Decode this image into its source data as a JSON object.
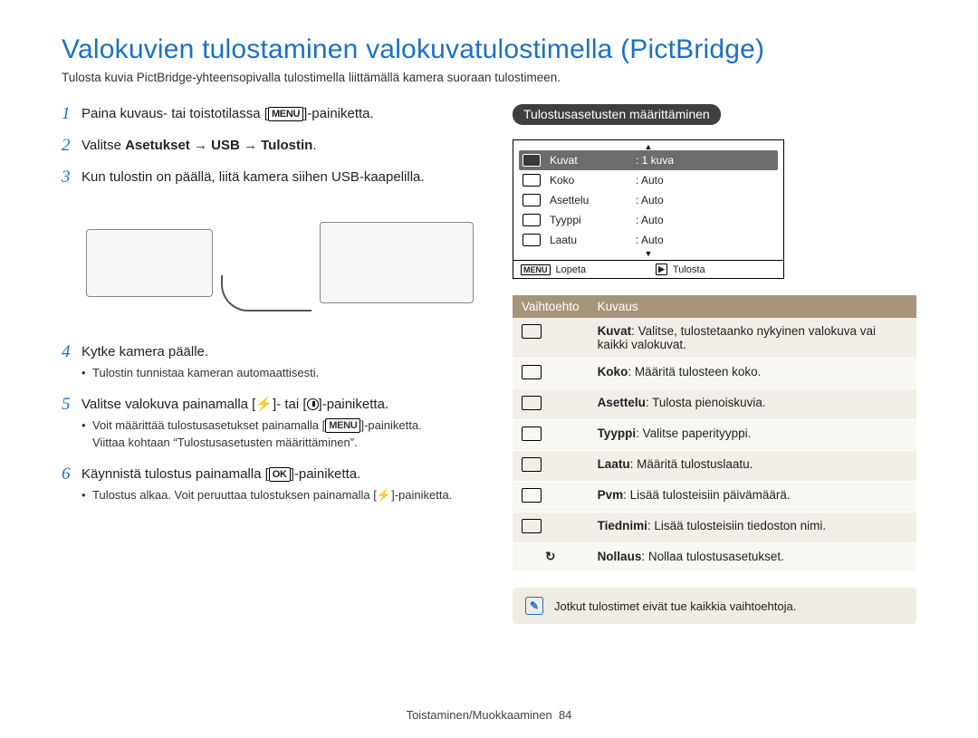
{
  "page": {
    "title": "Valokuvien tulostaminen valokuvatulostimella (PictBridge)",
    "subtitle": "Tulosta kuvia PictBridge-yhteensopivalla tulostimella liittämällä kamera suoraan tulostimeen.",
    "footer_section": "Toistaminen/Muokkaaminen",
    "footer_page": "84"
  },
  "buttons": {
    "menu": "MENU",
    "ok": "OK"
  },
  "steps": [
    {
      "n": "1",
      "parts": [
        "Paina kuvaus- tai toistotilassa [",
        "MENU",
        "]-painiketta."
      ]
    },
    {
      "n": "2",
      "parts_bold": [
        "Valitse ",
        "Asetukset → USB → Tulostin",
        "."
      ]
    },
    {
      "n": "3",
      "text": "Kun tulostin on päällä, liitä kamera siihen USB-kaapelilla."
    },
    {
      "n": "4",
      "text": "Kytke kamera päälle.",
      "bullets": [
        "Tulostin tunnistaa kameran automaattisesti."
      ]
    },
    {
      "n": "5",
      "parts": [
        "Valitse valokuva painamalla [",
        "flash",
        "]- tai [",
        "timer",
        "]-painiketta."
      ],
      "bullets": [
        "Voit määrittää tulostusasetukset painamalla [MENU]-painiketta. Viittaa kohtaan \"Tulostusasetusten määrittäminen\"."
      ],
      "bullets_rich": {
        "line1_pre": "Voit määrittää tulostusasetukset painamalla",
        "line1_btn": "MENU",
        "line1_post": "-painiketta.",
        "line2": "Viittaa kohtaan “Tulostusasetusten määrittäminen”."
      }
    },
    {
      "n": "6",
      "parts": [
        "Käynnistä tulostus painamalla [",
        "OK",
        "]-painiketta."
      ],
      "bullets_rich": {
        "line1_pre": "Tulostus alkaa. Voit peruuttaa tulostuksen painamalla",
        "line1_post": "-painiketta."
      }
    }
  ],
  "settings": {
    "heading": "Tulostusasetusten määrittäminen",
    "lcd": {
      "rows": [
        {
          "label": "Kuvat",
          "value": ": 1 kuva",
          "selected": true
        },
        {
          "label": "Koko",
          "value": ": Auto"
        },
        {
          "label": "Asettelu",
          "value": ": Auto"
        },
        {
          "label": "Tyyppi",
          "value": ": Auto"
        },
        {
          "label": "Laatu",
          "value": ": Auto"
        }
      ],
      "foot_left_key": "MENU",
      "foot_left": "Lopeta",
      "foot_right": "Tulosta"
    },
    "table": {
      "h1": "Vaihtoehto",
      "h2": "Kuvaus",
      "rows": [
        {
          "term": "Kuvat",
          "desc": ": Valitse, tulostetaanko nykyinen valokuva vai kaikki valokuvat."
        },
        {
          "term": "Koko",
          "desc": ": Määritä tulosteen koko."
        },
        {
          "term": "Asettelu",
          "desc": ": Tulosta pienoiskuvia."
        },
        {
          "term": "Tyyppi",
          "desc": ": Valitse paperityyppi."
        },
        {
          "term": "Laatu",
          "desc": ": Määritä tulostuslaatu."
        },
        {
          "term": "Pvm",
          "desc": ": Lisää tulosteisiin päivämäärä."
        },
        {
          "term": "Tiednimi",
          "desc": ": Lisää tulosteisiin tiedoston nimi."
        },
        {
          "term": "Nollaus",
          "desc": ": Nollaa tulostusasetukset."
        }
      ]
    },
    "note": "Jotkut tulostimet eivät tue kaikkia vaihtoehtoja."
  }
}
